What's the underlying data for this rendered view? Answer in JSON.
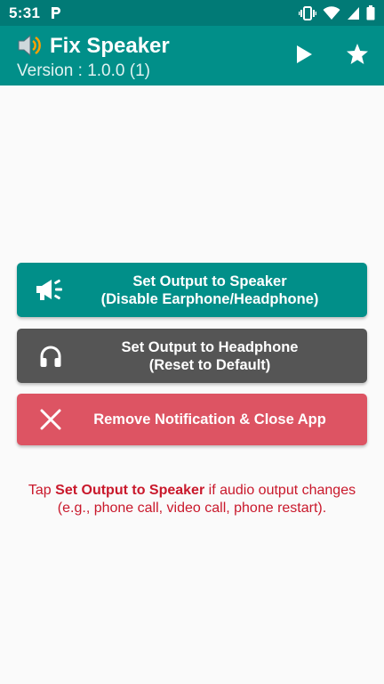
{
  "status_bar": {
    "time": "5:31",
    "icons": [
      "p-notification-icon",
      "vibrate-icon",
      "wifi-icon",
      "signal-icon",
      "battery-icon"
    ]
  },
  "app_bar": {
    "title": "Fix Speaker",
    "version": "Version : 1.0.0 (1)",
    "icons": [
      "speaker-app-icon",
      "play-icon",
      "star-icon"
    ]
  },
  "buttons": {
    "speaker": {
      "line1": "Set Output to Speaker",
      "line2": "(Disable Earphone/Headphone)",
      "icon": "megaphone-icon"
    },
    "headphone": {
      "line1": "Set Output to Headphone",
      "line2": "(Reset to Default)",
      "icon": "headphones-icon"
    },
    "remove": {
      "label": "Remove Notification & Close App",
      "icon": "close-icon"
    }
  },
  "hint": {
    "prefix": "Tap ",
    "emphasis": "Set Output to Speaker",
    "suffix": " if audio output changes",
    "line2": "(e.g., phone call, video call, phone restart)."
  },
  "colors": {
    "status_bar": "#017a76",
    "app_bar": "#018f89",
    "speaker_button": "#018f89",
    "headphone_button": "#555555",
    "remove_button": "#dd5463",
    "hint_text": "#c9182b",
    "background": "#fafafa"
  }
}
